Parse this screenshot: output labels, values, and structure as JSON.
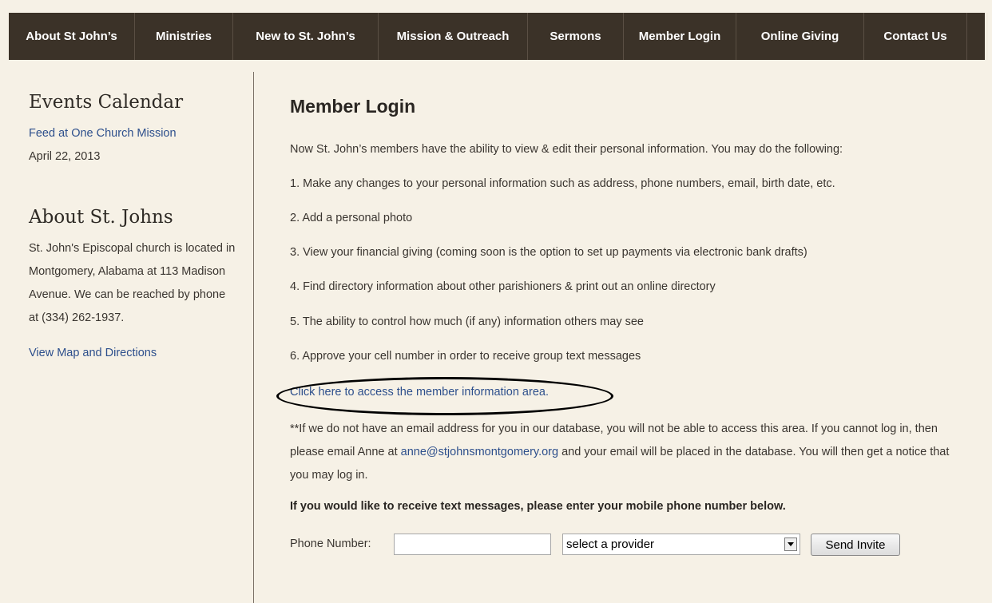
{
  "nav": {
    "items": [
      {
        "label": "About St John’s"
      },
      {
        "label": "Ministries"
      },
      {
        "label": "New to St. John’s"
      },
      {
        "label": "Mission & Outreach"
      },
      {
        "label": "Sermons"
      },
      {
        "label": "Member Login"
      },
      {
        "label": "Online Giving"
      },
      {
        "label": "Contact Us"
      }
    ]
  },
  "sidebar": {
    "events_heading": "Events Calendar",
    "event_link": "Feed at One Church Mission",
    "event_date": "April 22, 2013",
    "about_heading": "About St. Johns",
    "about_text": "St. John's Episcopal church is located in Montgomery, Alabama at 113 Madison Avenue. We can be reached by phone at (334) 262-1937.",
    "map_link": "View Map and Directions"
  },
  "main": {
    "title": "Member Login",
    "intro": "Now St. John’s members have the ability to view & edit their personal information.  You may do the following:",
    "items": [
      "1. Make any changes to your personal information such as address, phone numbers, email, birth date, etc.",
      "2. Add a personal photo",
      "3. View your financial giving (coming soon is the option to set up payments via electronic bank drafts)",
      "4. Find directory information about other parishioners & print out an online directory",
      "5. The ability to control how much (if any) information others may see",
      "6. Approve your cell number in order to receive group text messages"
    ],
    "access_link": "Click here to access the member information area.",
    "notice_before": "**If we do not have an  email address for you in our database, you will not be able to access this area.  If you cannot log in, then please email Anne at ",
    "notice_email": "anne@stjohnsmontgomery.org",
    "notice_after": " and your email will be placed in the database.  You will then get a notice that you may log in.",
    "text_prompt": "If you would like to receive text messages, please enter your mobile phone number below."
  },
  "form": {
    "phone_label": "Phone Number:",
    "phone_value": "",
    "provider_selected": "select a provider",
    "send_label": "Send Invite"
  },
  "colors": {
    "nav_bg": "#3b3228",
    "page_bg": "#f6f1e6",
    "link": "#2d4f8c"
  }
}
